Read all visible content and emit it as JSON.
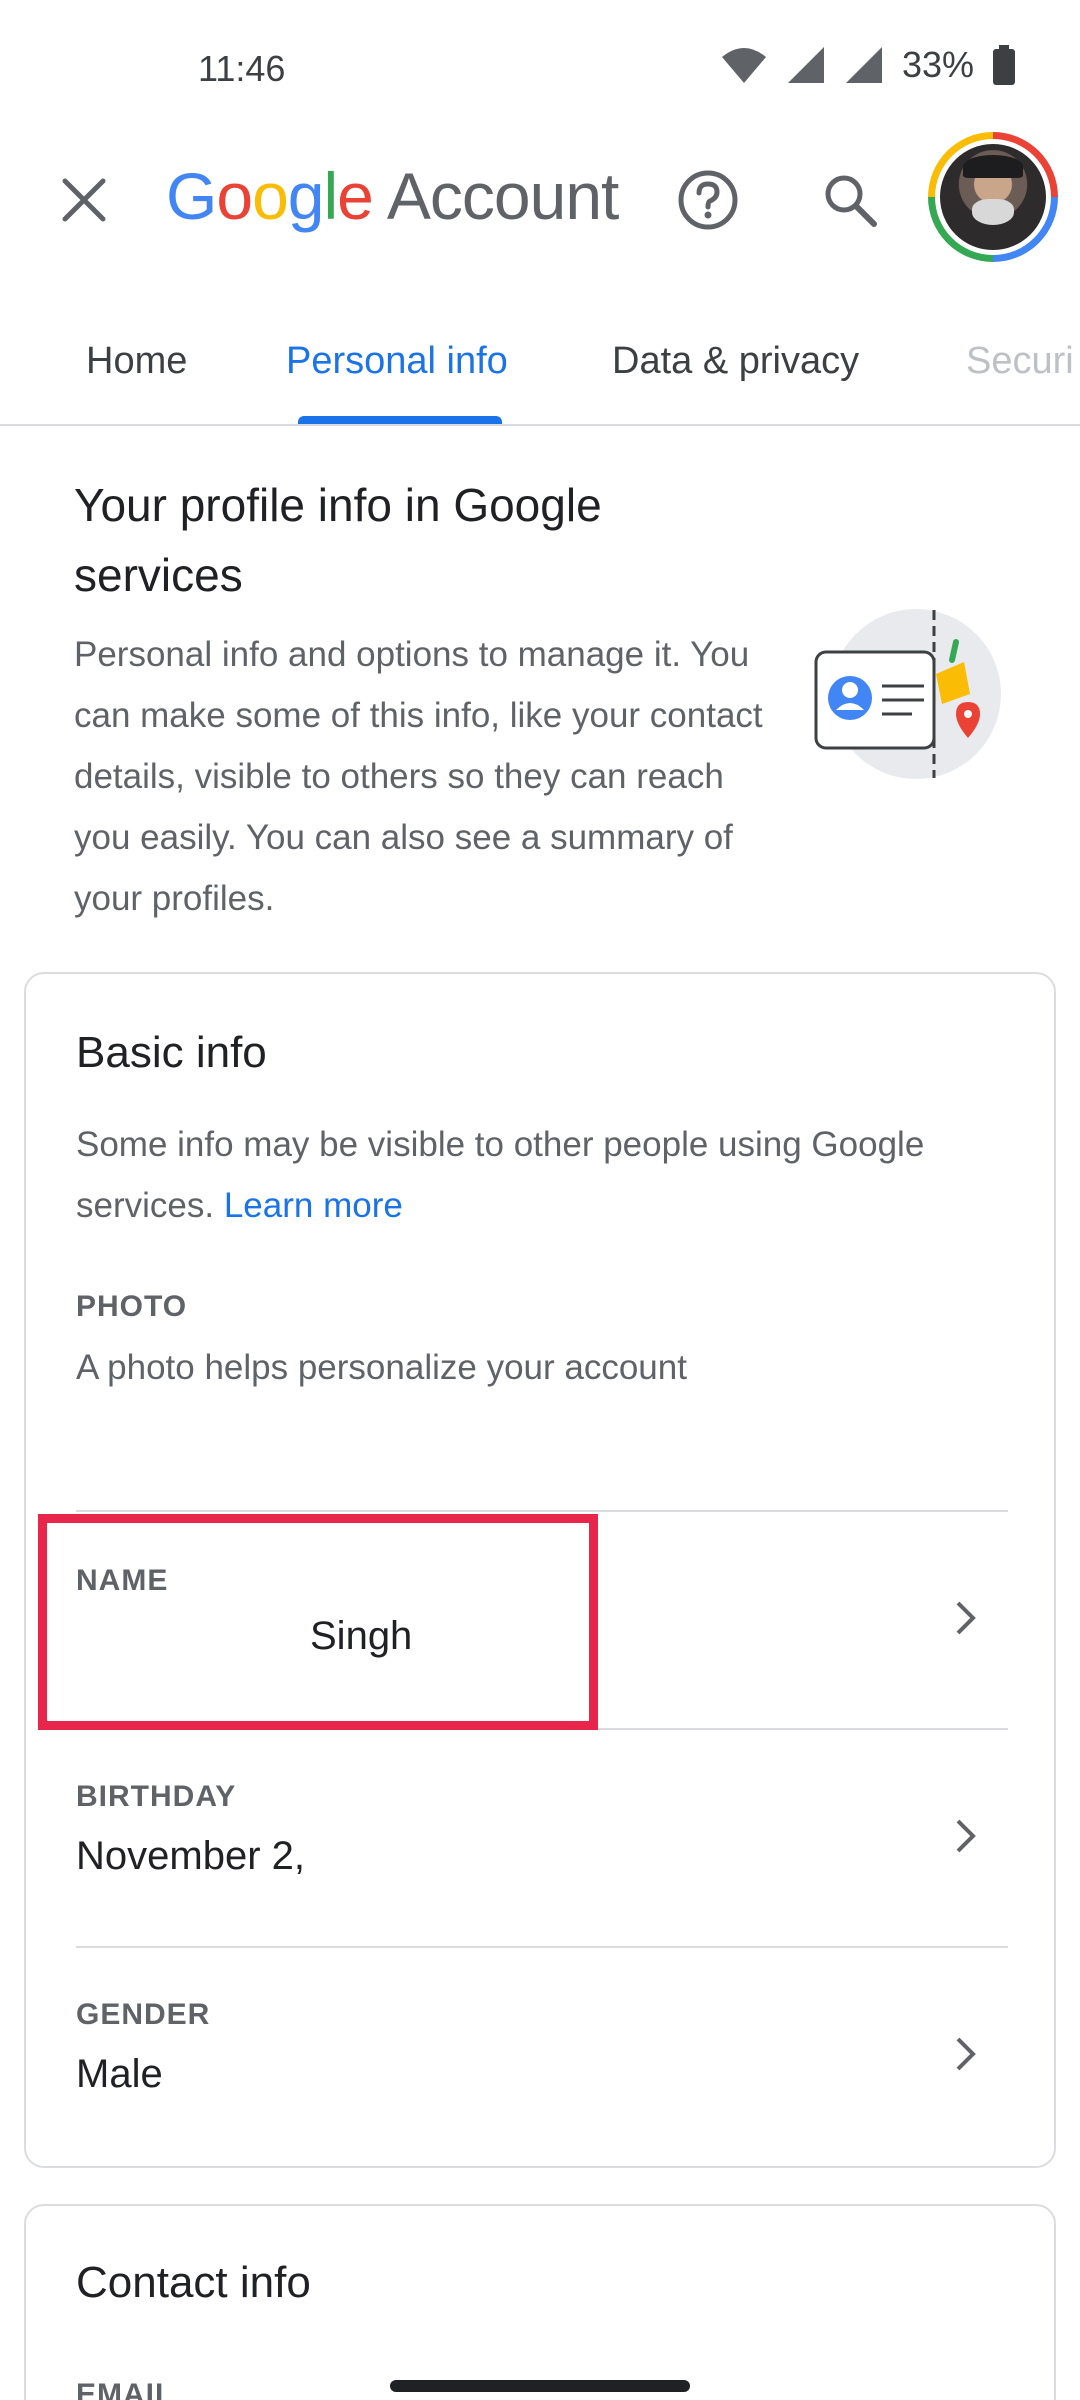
{
  "status_bar": {
    "time": "11:46",
    "battery": "33%",
    "icons": [
      "wifi-icon",
      "signal-icon",
      "signal-icon",
      "battery-icon"
    ]
  },
  "app_bar": {
    "brand_letters": [
      "G",
      "o",
      "o",
      "g",
      "l",
      "e"
    ],
    "brand_suffix": "Account",
    "icons": [
      "close-icon",
      "help-icon",
      "search-icon",
      "avatar"
    ]
  },
  "tabs": [
    {
      "label": "Home",
      "active": false
    },
    {
      "label": "Personal info",
      "active": true
    },
    {
      "label": "Data & privacy",
      "active": false
    },
    {
      "label": "Securi",
      "active": false
    }
  ],
  "intro": {
    "title": "Your profile info in Google services",
    "description": "Personal info and options to manage it. You can make some of this info, like your contact details, visible to others so they can reach you easily. You can also see a summary of your profiles."
  },
  "basic_info": {
    "title": "Basic info",
    "description": "Some info may be visible to other people using Google services.",
    "learn_more": "Learn more",
    "photo": {
      "label": "PHOTO",
      "hint": "A photo helps personalize your account"
    },
    "name": {
      "label": "NAME",
      "value": "Singh"
    },
    "birthday": {
      "label": "BIRTHDAY",
      "value": "November 2,"
    },
    "gender": {
      "label": "GENDER",
      "value": "Male"
    }
  },
  "contact_info": {
    "title": "Contact info",
    "email_label": "EMAIL"
  },
  "colors": {
    "accent": "#1a73e8",
    "highlight": "#e8264b",
    "google_blue": "#4285f4",
    "google_red": "#ea4335",
    "google_yellow": "#fbbc05",
    "google_green": "#34a853"
  }
}
